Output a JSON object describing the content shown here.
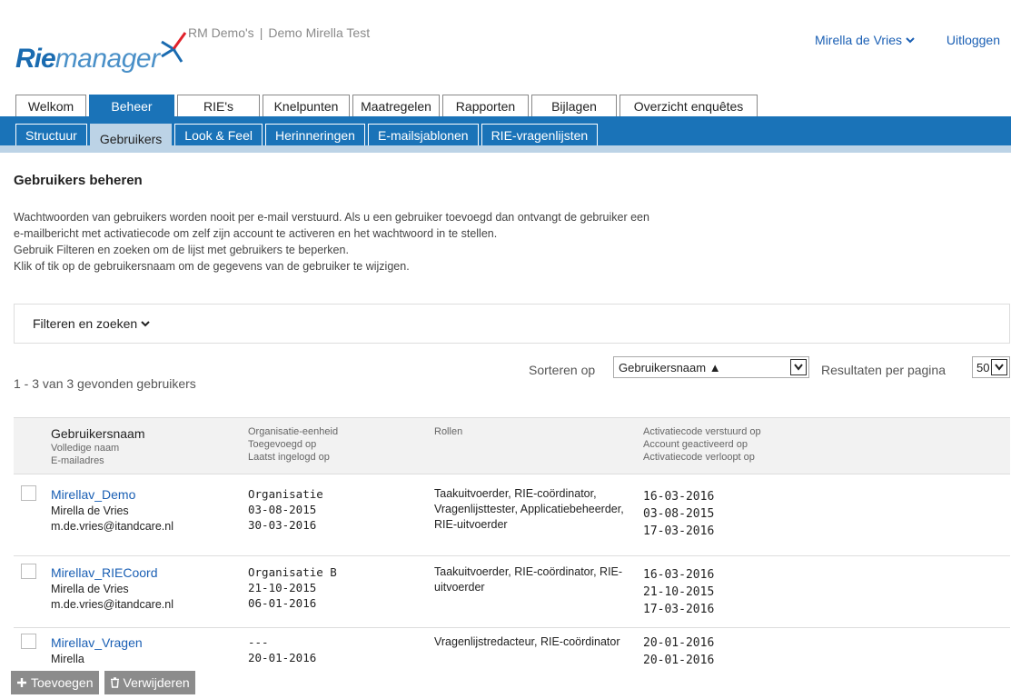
{
  "header": {
    "logo_rie": "Rie",
    "logo_manager": "manager",
    "crumb_org": "RM Demo's",
    "crumb_sep": "|",
    "crumb_env": "Demo Mirella Test",
    "user_name": "Mirella de Vries",
    "logout": "Uitloggen"
  },
  "main_tabs": [
    "Welkom",
    "Beheer",
    "RIE's",
    "Knelpunten",
    "Maatregelen",
    "Rapporten",
    "Bijlagen",
    "Overzicht enquêtes"
  ],
  "active_main_tab": "Beheer",
  "sub_tabs": [
    "Structuur",
    "Gebruikers",
    "Look & Feel",
    "Herinneringen",
    "E-mailsjablonen",
    "RIE-vragenlijsten"
  ],
  "active_sub_tab": "Gebruikers",
  "page": {
    "title": "Gebruikers beheren",
    "desc_1": "Wachtwoorden van gebruikers worden nooit per e-mail verstuurd. Als u een gebruiker toevoegd dan ontvangt de gebruiker een e-mailbericht met activatiecode om zelf zijn account te activeren en het wachtwoord in te stellen.",
    "desc_2": "Gebruik Filteren en zoeken om de lijst met gebruikers te beperken.",
    "desc_3": "Klik of tik op de gebruikersnaam om de gegevens van de gebruiker te wijzigen.",
    "filter_label": "Filteren en zoeken",
    "sort_label": "Sorteren op",
    "sort_value": "Gebruikersnaam ▲",
    "rpp_label": "Resultaten per pagina",
    "rpp_value": "50",
    "count": "1 - 3 van 3 gevonden gebruikers"
  },
  "table_header": {
    "user_main": "Gebruikersnaam",
    "user_sub1": "Volledige naam",
    "user_sub2": "E-mailadres",
    "org_1": "Organisatie-eenheid",
    "org_2": "Toegevoegd op",
    "org_3": "Laatst ingelogd op",
    "roles": "Rollen",
    "act_1": "Activatiecode verstuurd op",
    "act_2": "Account geactiveerd op",
    "act_3": "Activatiecode verloopt op"
  },
  "rows": [
    {
      "username": "Mirellav_Demo",
      "fullname": "Mirella de Vries",
      "email": "m.de.vries@itandcare.nl",
      "org": "Organisatie",
      "added": "03-08-2015",
      "last_login": "30-03-2016",
      "roles": "Taakuitvoerder, RIE-coördinator, Vragenlijsttester, Applicatiebeheerder, RIE-uitvoerder",
      "act_sent": "16-03-2016",
      "activated": "03-08-2015",
      "expires": "17-03-2016"
    },
    {
      "username": "Mirellav_RIECoord",
      "fullname": "Mirella de Vries",
      "email": "m.de.vries@itandcare.nl",
      "org": "Organisatie B",
      "added": "21-10-2015",
      "last_login": "06-01-2016",
      "roles": "Taakuitvoerder, RIE-coördinator, RIE-uitvoerder",
      "act_sent": "16-03-2016",
      "activated": "21-10-2015",
      "expires": "17-03-2016"
    },
    {
      "username": "Mirellav_Vragen",
      "fullname": "Mirella",
      "email": "",
      "org": "---",
      "added": "20-01-2016",
      "last_login": "",
      "roles": "Vragenlijstredacteur, RIE-coördinator",
      "act_sent": "20-01-2016",
      "activated": "20-01-2016",
      "expires": ""
    }
  ],
  "footer": {
    "add_label": "Toevoegen",
    "delete_label": "Verwijderen"
  },
  "colors": {
    "brand_blue": "#1a73b8",
    "link_blue": "#1a5fb4",
    "subnav_strip": "#bcd3e6"
  }
}
